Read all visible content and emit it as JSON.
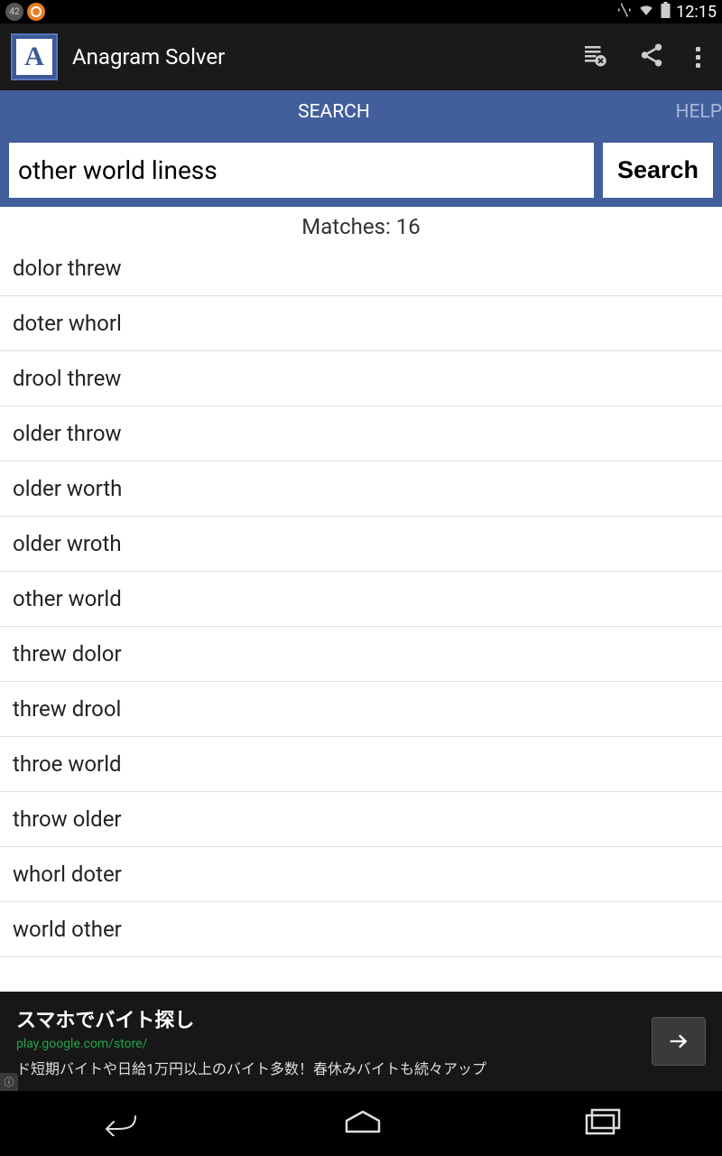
{
  "status": {
    "badge": "42",
    "time": "12:15"
  },
  "app": {
    "logo_letter": "A",
    "title": "Anagram Solver"
  },
  "tabs": {
    "search": "SEARCH",
    "help": "HELP"
  },
  "search": {
    "value": "other world liness",
    "button": "Search"
  },
  "matches": {
    "label": "Matches: 16"
  },
  "results": [
    "dolor threw",
    "doter whorl",
    "drool threw",
    "older throw",
    "older worth",
    "older wroth",
    "other world",
    "threw dolor",
    "threw drool",
    "throe world",
    "throw older",
    "whorl doter",
    "world other"
  ],
  "ad": {
    "title": "スマホでバイト探し",
    "url": "play.google.com/store/",
    "desc": "ド短期バイトや日給1万円以上のバイト多数！春休みバイトも続々アップ",
    "info": "ⓘ"
  }
}
